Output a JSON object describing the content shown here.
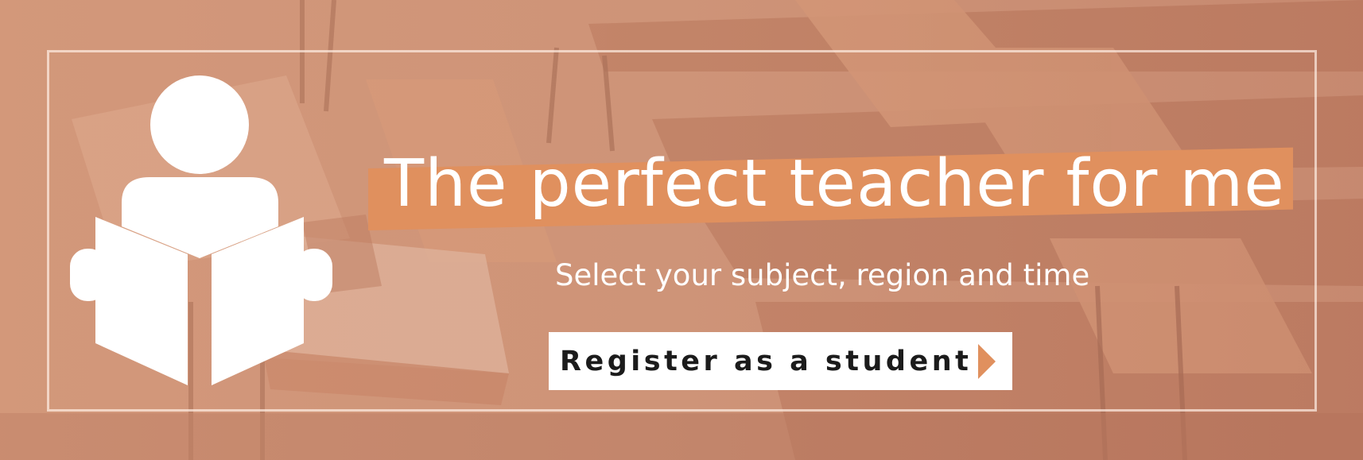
{
  "banner": {
    "title": "The perfect teacher for me",
    "subtitle": "Select your subject, region and time",
    "cta_label": "Register as a student",
    "icons": {
      "reader": "reading-person-icon",
      "cta_arrow": "caret-right-icon"
    },
    "colors": {
      "accent": "#e0905e",
      "text": "#ffffff",
      "cta_background": "#ffffff",
      "cta_text": "#1b1b1b"
    }
  }
}
